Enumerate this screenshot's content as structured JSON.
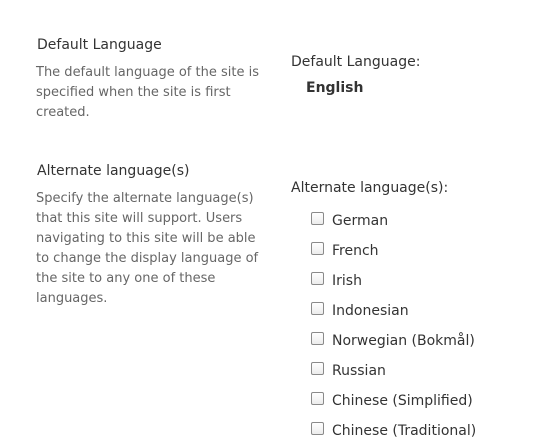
{
  "default_language_section": {
    "title": "Default Language",
    "description": "The default language of the site is specified when the site is first created.",
    "field_label": "Default Language:",
    "value": "English"
  },
  "alternate_language_section": {
    "title": "Alternate language(s)",
    "description": "Specify the alternate language(s) that this site will support. Users navigating to this site will be able to change the display language of the site to any one of these languages.",
    "field_label": "Alternate language(s):",
    "languages": [
      {
        "label": "German",
        "checked": false
      },
      {
        "label": "French",
        "checked": false
      },
      {
        "label": "Irish",
        "checked": false
      },
      {
        "label": "Indonesian",
        "checked": false
      },
      {
        "label": "Norwegian (Bokmål)",
        "checked": false
      },
      {
        "label": "Russian",
        "checked": false
      },
      {
        "label": "Chinese (Simplified)",
        "checked": false
      },
      {
        "label": "Chinese (Traditional)",
        "checked": false
      }
    ]
  }
}
